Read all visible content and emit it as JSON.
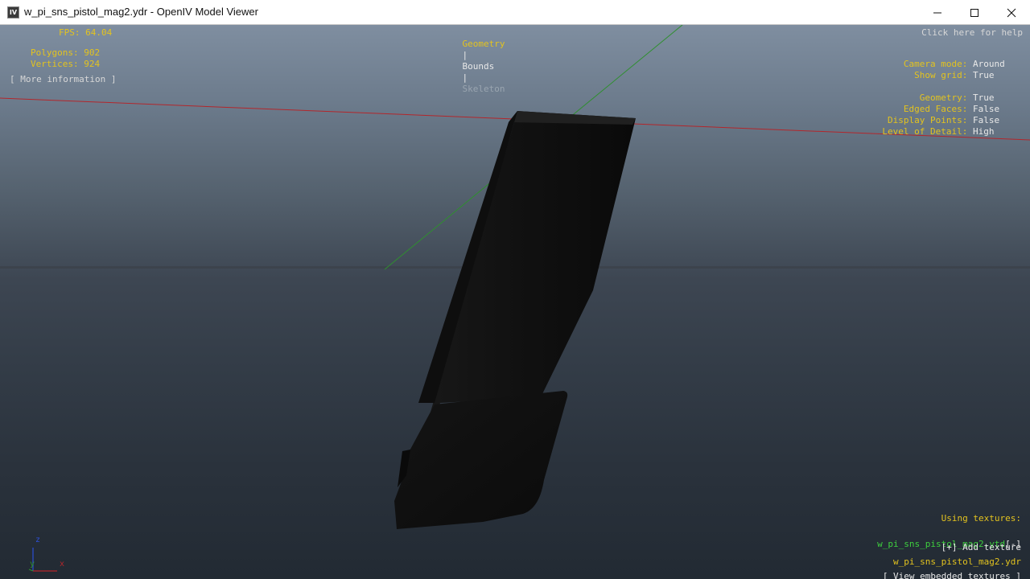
{
  "window": {
    "icon_text": "IV",
    "title": "w_pi_sns_pistol_mag2.ydr - OpenIV Model Viewer"
  },
  "stats": {
    "fps": "FPS: 64.04",
    "polygons": "Polygons: 902",
    "vertices": "Vertices: 924",
    "more_info": "[ More information ]"
  },
  "modes": {
    "geometry": "Geometry",
    "sep1": "|",
    "bounds": "Bounds",
    "sep2": "|",
    "skeleton": "Skeleton"
  },
  "help": "Click here for help",
  "settings": [
    {
      "label": "Camera mode:",
      "value": "Around"
    },
    {
      "label": "Show grid:",
      "value": "True"
    },
    {
      "label": "Geometry:",
      "value": "True"
    },
    {
      "label": "Edged Faces:",
      "value": "False"
    },
    {
      "label": "Display Points:",
      "value": "False"
    },
    {
      "label": "Level of Detail:",
      "value": "High"
    }
  ],
  "textures": {
    "heading": "Using textures:",
    "ytd": "w_pi_sns_pistol_mag2.ytd",
    "remove": "[-]",
    "add": "[+] Add texture",
    "ydr": "w_pi_sns_pistol_mag2.ydr",
    "view_embedded": "[ View embedded textures ]"
  },
  "axes": {
    "z": "z",
    "y": "y",
    "x": "x"
  },
  "colors": {
    "hud_yellow": "#e3c31f",
    "hud_green": "#3ecf3e",
    "axis_red": "#b3262b",
    "axis_green": "#2f8f2f",
    "axis_blue": "#2d4fd6"
  }
}
